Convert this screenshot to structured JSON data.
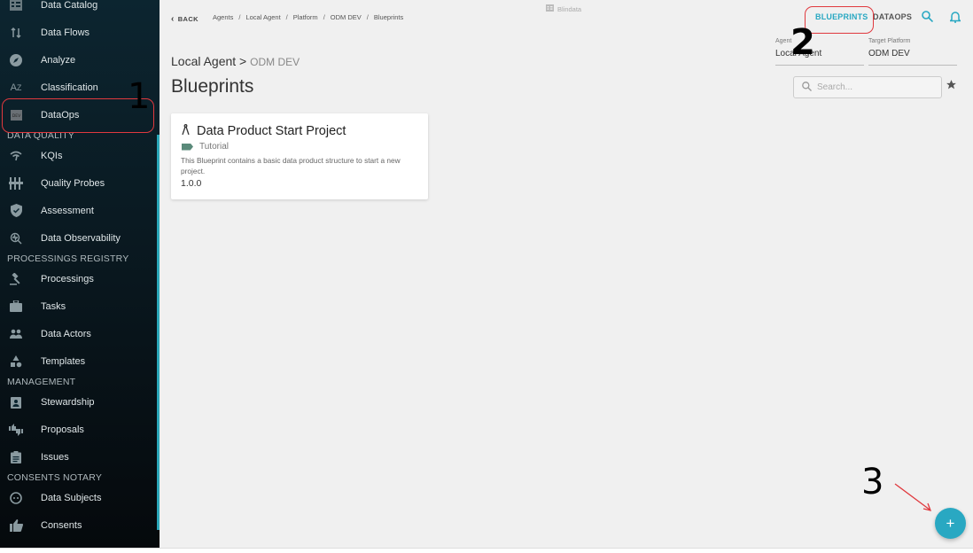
{
  "sidebar": {
    "items": [
      {
        "label": "Data Catalog",
        "icon": "catalog-icon"
      },
      {
        "label": "Data Flows",
        "icon": "data-flows-icon"
      },
      {
        "label": "Analyze",
        "icon": "compass-icon"
      },
      {
        "label": "Classification",
        "icon": "az-sort-icon"
      },
      {
        "label": "DataOps",
        "icon": "dataops-icon",
        "highlighted": true
      }
    ],
    "sections": [
      {
        "title": "DATA QUALITY",
        "items": [
          {
            "label": "KQIs",
            "icon": "wifi-signal-icon"
          },
          {
            "label": "Quality Probes",
            "icon": "probes-icon"
          },
          {
            "label": "Assessment",
            "icon": "shield-check-icon"
          },
          {
            "label": "Data Observability",
            "icon": "observability-icon"
          }
        ]
      },
      {
        "title": "PROCESSINGS REGISTRY",
        "items": [
          {
            "label": "Processings",
            "icon": "gavel-icon"
          },
          {
            "label": "Tasks",
            "icon": "briefcase-icon"
          },
          {
            "label": "Data Actors",
            "icon": "people-icon"
          },
          {
            "label": "Templates",
            "icon": "shapes-icon"
          }
        ]
      },
      {
        "title": "MANAGEMENT",
        "items": [
          {
            "label": "Stewardship",
            "icon": "badge-icon"
          },
          {
            "label": "Proposals",
            "icon": "thumbs-icon"
          },
          {
            "label": "Issues",
            "icon": "clipboard-icon"
          }
        ]
      },
      {
        "title": "CONSENTS NOTARY",
        "items": [
          {
            "label": "Data Subjects",
            "icon": "face-icon"
          },
          {
            "label": "Consents",
            "icon": "thumb-up-icon"
          }
        ]
      }
    ]
  },
  "header": {
    "back_label": "BACK",
    "breadcrumbs": [
      "Agents",
      "Local Agent",
      "Platform",
      "ODM DEV",
      "Blueprints"
    ],
    "brand": "Blindata",
    "nav": {
      "blueprints": "BLUEPRINTS",
      "dataops": "DATAOPS"
    },
    "subtitle_main": "Local Agent >",
    "subtitle_secondary": "ODM DEV",
    "title": "Blueprints"
  },
  "fields": {
    "agent": {
      "label": "Agent",
      "value": "Local Agent"
    },
    "target_platform": {
      "label": "Target Platform",
      "value": "ODM DEV"
    }
  },
  "search": {
    "placeholder": "Search...",
    "value": ""
  },
  "cards": [
    {
      "title": "Data Product Start Project",
      "tag": "Tutorial",
      "description": "This Blueprint contains a basic data product structure to start a new project.",
      "version": "1.0.0"
    }
  ],
  "fab": {
    "label": "+"
  },
  "annotations": [
    "1",
    "2",
    "3"
  ],
  "colors": {
    "accent": "#29a8c2",
    "annotation": "#e0393e",
    "tag": "#5a8a7a"
  }
}
